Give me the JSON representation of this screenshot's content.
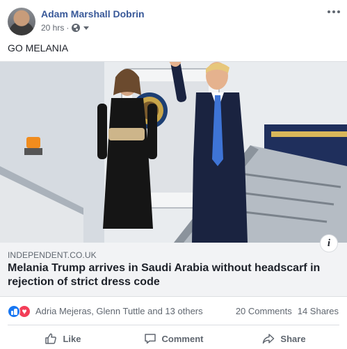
{
  "post": {
    "author": "Adam Marshall Dobrin",
    "timestamp": "20 hrs",
    "separator": "·",
    "privacy_icon": "globe-icon",
    "status_text": "GO MELANIA"
  },
  "link": {
    "domain": "INDEPENDENT.CO.UK",
    "title": "Melania Trump arrives in Saudi Arabia without headscarf in rejection of strict dress code",
    "info_icon_label": "i"
  },
  "reactions": {
    "icons": [
      "like-reaction-icon",
      "love-reaction-icon"
    ],
    "summary": "Adria Mejeras, Glenn Tuttle and 13 others",
    "comments": "20 Comments",
    "shares": "14 Shares"
  },
  "actions": {
    "like_label": "Like",
    "comment_label": "Comment",
    "share_label": "Share"
  },
  "colors": {
    "author_link": "#385898",
    "secondary_text": "#606770",
    "like_blue": "#1877f2",
    "love_red": "#f33e58",
    "card_bg": "#f2f3f5"
  }
}
